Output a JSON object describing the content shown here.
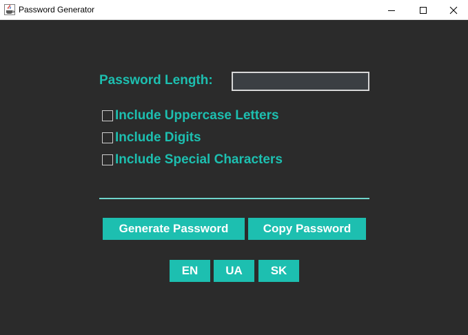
{
  "window": {
    "title": "Password Generator"
  },
  "form": {
    "length_label": "Password Length:",
    "length_value": "",
    "options": [
      {
        "label": "Include Uppercase Letters",
        "checked": false
      },
      {
        "label": "Include Digits",
        "checked": false
      },
      {
        "label": "Include Special Characters",
        "checked": false
      }
    ],
    "result": ""
  },
  "actions": {
    "generate_label": "Generate Password",
    "copy_label": "Copy Password"
  },
  "languages": [
    "EN",
    "UA",
    "SK"
  ],
  "colors": {
    "background": "#2b2b2b",
    "accent": "#1dbfb0",
    "input_background": "#3b3f43",
    "underline": "#6fd6cc"
  },
  "icons": {
    "app": "java-cup-icon",
    "minimize": "minimize-icon",
    "maximize": "maximize-icon",
    "close": "close-icon"
  }
}
